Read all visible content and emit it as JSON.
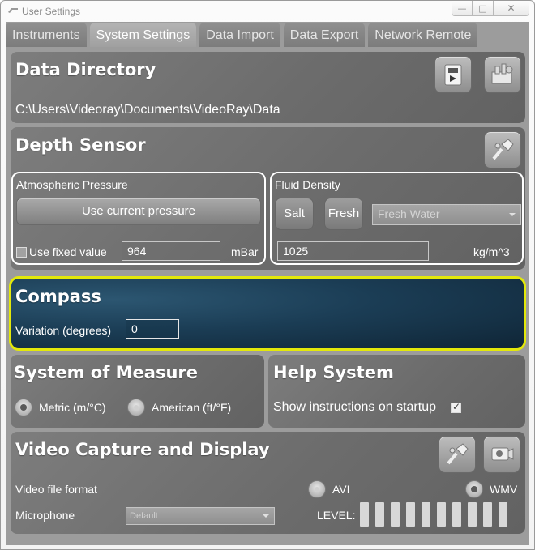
{
  "window": {
    "title": "User Settings",
    "minimize": "—",
    "maximize": "□",
    "close": "✕"
  },
  "tabs": [
    "Instruments",
    "System Settings",
    "Data Import",
    "Data Export",
    "Network Remote"
  ],
  "active_tab": "System Settings",
  "data_directory": {
    "title": "Data Directory",
    "path": "C:\\Users\\Videoray\\Documents\\VideoRay\\Data"
  },
  "depth_sensor": {
    "title": "Depth Sensor",
    "atmospheric": {
      "label": "Atmospheric Pressure",
      "use_current_button": "Use current pressure",
      "use_fixed_label": "Use fixed value",
      "use_fixed_checked": false,
      "value": "964",
      "unit": "mBar"
    },
    "fluid": {
      "label": "Fluid Density",
      "salt_button": "Salt",
      "fresh_button": "Fresh",
      "select_value": "Fresh Water",
      "value": "1025",
      "unit": "kg/m^3"
    }
  },
  "compass": {
    "title": "Compass",
    "variation_label": "Variation (degrees)",
    "variation_value": "0",
    "highlight_color": "#e3e80a"
  },
  "system_of_measure": {
    "title": "System of Measure",
    "options": [
      "Metric (m/°C)",
      "American (ft/°F)"
    ],
    "selected": "Metric (m/°C)"
  },
  "help_system": {
    "title": "Help System",
    "show_instructions_label": "Show instructions on startup",
    "show_instructions_checked": true
  },
  "video": {
    "title": "Video Capture and Display",
    "file_format_label": "Video file format",
    "formats": [
      "AVI",
      "WMV"
    ],
    "selected_format": "WMV",
    "microphone_label": "Microphone",
    "microphone_value": "Default",
    "level_label": "LEVEL:",
    "level_bars": 10
  },
  "icons": {
    "folder_open": "folder-open-icon",
    "folder_settings": "folder-settings-icon",
    "depth_tool": "depth-calibrate-icon",
    "video_tool": "video-settings-icon",
    "camera": "video-camera-icon"
  }
}
